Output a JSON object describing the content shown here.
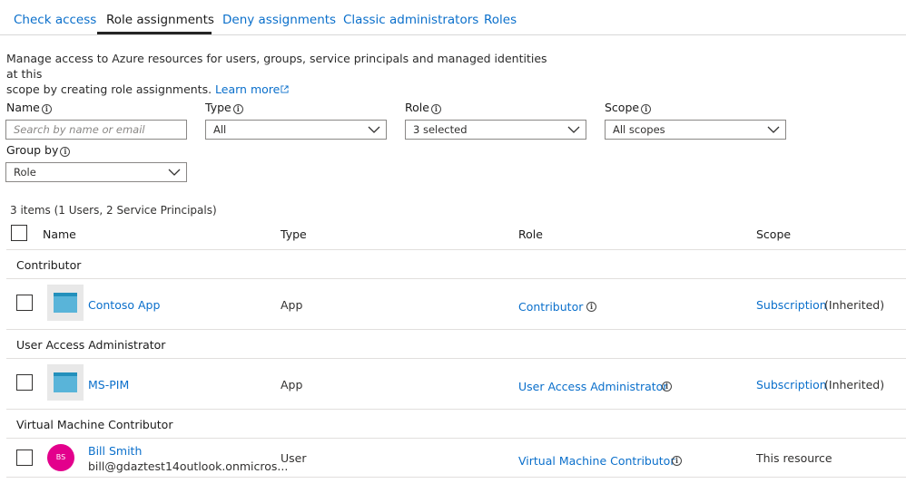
{
  "tabs": [
    {
      "label": "Check access"
    },
    {
      "label": "Role assignments"
    },
    {
      "label": "Deny assignments"
    },
    {
      "label": "Classic administrators"
    },
    {
      "label": "Roles"
    }
  ],
  "description": {
    "line1": "Manage access to Azure resources for users, groups, service principals and managed identities at this",
    "line2": "scope by creating role assignments. ",
    "learn_more": "Learn more"
  },
  "filters": {
    "name": {
      "label": "Name",
      "placeholder": "Search by name or email"
    },
    "type": {
      "label": "Type",
      "value": "All"
    },
    "role": {
      "label": "Role",
      "value": "3 selected"
    },
    "scope": {
      "label": "Scope",
      "value": "All scopes"
    },
    "group_by": {
      "label": "Group by",
      "value": "Role"
    }
  },
  "items_count": "3 items (1 Users, 2 Service Principals)",
  "columns": {
    "name": "Name",
    "type": "Type",
    "role": "Role",
    "scope": "Scope"
  },
  "groups": [
    {
      "title": "Contributor",
      "row": {
        "name": "Contoso App",
        "type": "App",
        "role": "Contributor",
        "scope_link": "Subscription",
        "scope_suffix": "(Inherited)"
      }
    },
    {
      "title": "User Access Administrator",
      "row": {
        "name": "MS-PIM",
        "type": "App",
        "role": "User Access Administrator",
        "scope_link": "Subscription",
        "scope_suffix": "(Inherited)"
      }
    },
    {
      "title": "Virtual Machine Contributor",
      "row": {
        "name": "Bill Smith",
        "email": "bill@gdaztest14outlook.onmicros...",
        "initials": "BS",
        "type": "User",
        "role": "Virtual Machine Contributor",
        "scope_text": "This resource"
      }
    }
  ],
  "colors": {
    "link": "#0a6fcb",
    "avatar_user": "#e3008c",
    "app_icon": "#59b4d9"
  }
}
